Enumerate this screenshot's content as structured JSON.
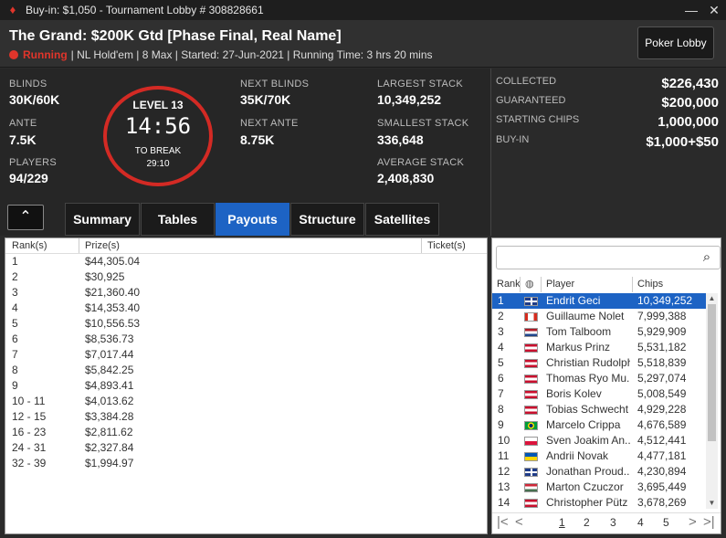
{
  "window": {
    "title": "Buy-in: $1,050 - Tournament Lobby # 308828661",
    "minimize": "—",
    "close": "✕"
  },
  "header": {
    "name": "The Grand: $200K Gtd [Phase Final, Real Name]",
    "status": "Running",
    "details": "| NL Hold'em | 8 Max | Started: 27-Jun-2021 | Running Time: 3 hrs  20 mins",
    "lobby_button": "Poker Lobby"
  },
  "stats": {
    "blinds_label": "BLINDS",
    "blinds": "30K/60K",
    "ante_label": "ANTE",
    "ante": "7.5K",
    "players_label": "PLAYERS",
    "players": "94/229",
    "next_blinds_label": "NEXT BLINDS",
    "next_blinds": "35K/70K",
    "next_ante_label": "NEXT ANTE",
    "next_ante": "8.75K",
    "largest_label": "LARGEST STACK",
    "largest": "10,349,252",
    "smallest_label": "SMALLEST STACK",
    "smallest": "336,648",
    "average_label": "AVERAGE STACK",
    "average": "2,408,830"
  },
  "level": {
    "label": "LEVEL 13",
    "time": "14:56",
    "break_label": "TO BREAK",
    "break_time": "29:10"
  },
  "prize": {
    "collected_label": "COLLECTED",
    "collected": "$226,430",
    "guaranteed_label": "GUARANTEED",
    "guaranteed": "$200,000",
    "chips_label": "STARTING CHIPS",
    "chips": "1,000,000",
    "buyin_label": "BUY-IN",
    "buyin": "$1,000+$50"
  },
  "tabs": {
    "collapse": "⌃",
    "summary": "Summary",
    "tables": "Tables",
    "payouts": "Payouts",
    "structure": "Structure",
    "satellites": "Satellites"
  },
  "payouts": {
    "headers": {
      "rank": "Rank(s)",
      "prize": "Prize(s)",
      "ticket": "Ticket(s)"
    },
    "rows": [
      {
        "rank": "1",
        "prize": "$44,305.04"
      },
      {
        "rank": "2",
        "prize": "$30,925"
      },
      {
        "rank": "3",
        "prize": "$21,360.40"
      },
      {
        "rank": "4",
        "prize": "$14,353.40"
      },
      {
        "rank": "5",
        "prize": "$10,556.53"
      },
      {
        "rank": "6",
        "prize": "$8,536.73"
      },
      {
        "rank": "7",
        "prize": "$7,017.44"
      },
      {
        "rank": "8",
        "prize": "$5,842.25"
      },
      {
        "rank": "9",
        "prize": "$4,893.41"
      },
      {
        "rank": "10 - 11",
        "prize": "$4,013.62"
      },
      {
        "rank": "12 - 15",
        "prize": "$3,384.28"
      },
      {
        "rank": "16 - 23",
        "prize": "$2,811.62"
      },
      {
        "rank": "24 - 31",
        "prize": "$2,327.84"
      },
      {
        "rank": "32 - 39",
        "prize": "$1,994.97"
      }
    ]
  },
  "players_panel": {
    "search_placeholder": "",
    "headers": {
      "rank": "Rank",
      "player": "Player",
      "chips": "Chips"
    },
    "rows": [
      {
        "rank": "1",
        "flag": "gb",
        "name": "Endrit Geci",
        "chips": "10,349,252"
      },
      {
        "rank": "2",
        "flag": "ca",
        "name": "Guillaume Nolet",
        "chips": "7,999,388"
      },
      {
        "rank": "3",
        "flag": "nl",
        "name": "Tom Talboom",
        "chips": "5,929,909"
      },
      {
        "rank": "4",
        "flag": "at",
        "name": "Markus Prinz",
        "chips": "5,531,182"
      },
      {
        "rank": "5",
        "flag": "at",
        "name": "Christian Rudolph",
        "chips": "5,518,839"
      },
      {
        "rank": "6",
        "flag": "at",
        "name": "Thomas Ryo Mu...",
        "chips": "5,297,074"
      },
      {
        "rank": "7",
        "flag": "at",
        "name": "Boris Kolev",
        "chips": "5,008,549"
      },
      {
        "rank": "8",
        "flag": "at",
        "name": "Tobias Schwecht",
        "chips": "4,929,228"
      },
      {
        "rank": "9",
        "flag": "br",
        "name": "Marcelo Crippa",
        "chips": "4,676,589"
      },
      {
        "rank": "10",
        "flag": "pl",
        "name": "Sven Joakim An...",
        "chips": "4,512,441"
      },
      {
        "rank": "11",
        "flag": "ua",
        "name": "Andrii Novak",
        "chips": "4,477,181"
      },
      {
        "rank": "12",
        "flag": "gb",
        "name": "Jonathan Proud...",
        "chips": "4,230,894"
      },
      {
        "rank": "13",
        "flag": "hu",
        "name": "Marton Czuczor",
        "chips": "3,695,449"
      },
      {
        "rank": "14",
        "flag": "at",
        "name": "Christopher Pütz",
        "chips": "3,678,269"
      }
    ],
    "pages": [
      "1",
      "2",
      "3",
      "4",
      "5"
    ],
    "current_page": "1"
  }
}
